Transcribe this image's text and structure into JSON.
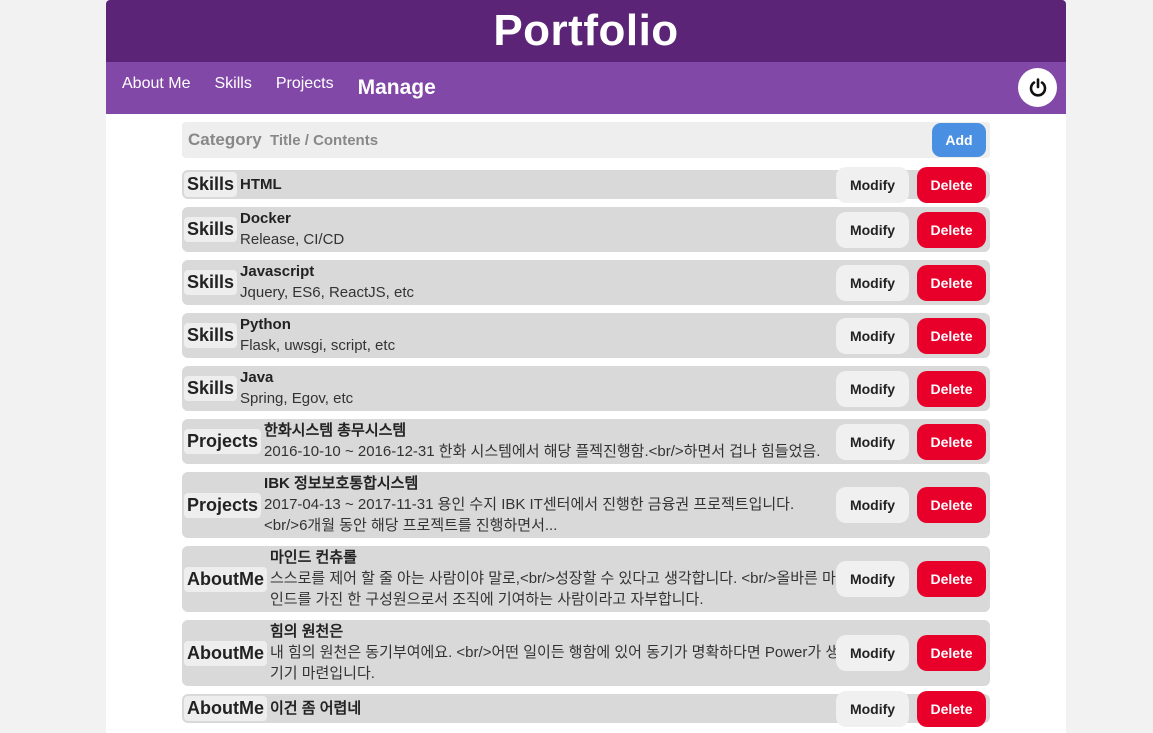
{
  "header": {
    "title": "Portfolio"
  },
  "nav": {
    "items": [
      "About Me",
      "Skills",
      "Projects"
    ],
    "active": "Manage"
  },
  "form": {
    "category_placeholder": "Category",
    "title_placeholder": "Title / Contents",
    "add_label": "Add"
  },
  "buttons": {
    "modify": "Modify",
    "delete": "Delete"
  },
  "colors": {
    "header_bg": "#5c2477",
    "nav_bg": "#8248a8",
    "add_btn": "#4a90e2",
    "delete_btn": "#e8002a",
    "row_bg": "#d9d9d9"
  },
  "icons": {
    "power": "power-icon"
  },
  "items": [
    {
      "category": "Skills",
      "title": "HTML",
      "desc": ""
    },
    {
      "category": "Skills",
      "title": "Docker",
      "desc": "Release, CI/CD"
    },
    {
      "category": "Skills",
      "title": "Javascript",
      "desc": "Jquery, ES6, ReactJS, etc"
    },
    {
      "category": "Skills",
      "title": "Python",
      "desc": "Flask, uwsgi, script, etc"
    },
    {
      "category": "Skills",
      "title": "Java",
      "desc": "Spring, Egov, etc"
    },
    {
      "category": "Projects",
      "title": "한화시스템 총무시스템",
      "desc": "2016-10-10 ~ 2016-12-31 한화 시스템에서 해당 플젝진행함.<br/>하면서 겁나 힘들었음."
    },
    {
      "category": "Projects",
      "title": "IBK 정보보호통합시스템",
      "desc": "2017-04-13 ~ 2017-11-31 용인 수지 IBK IT센터에서 진행한 금융권 프로젝트입니다. <br/>6개월 동안 해당 프로젝트를 진행하면서..."
    },
    {
      "category": "AboutMe",
      "title": "마인드 컨츄롤",
      "desc": "스스로를 제어 할 줄 아는 사람이야 말로,<br/>성장할 수 있다고 생각합니다. <br/>올바른 마인드를 가진 한 구성원으로서 조직에 기여하는 사람이라고 자부합니다."
    },
    {
      "category": "AboutMe",
      "title": "힘의 원천은",
      "desc": "내 힘의 원천은 동기부여에요. <br/>어떤 일이든 행함에 있어 동기가 명확하다면 Power가 생기기 마련입니다."
    },
    {
      "category": "AboutMe",
      "title": "이건 좀 어렵네",
      "desc": ""
    }
  ]
}
